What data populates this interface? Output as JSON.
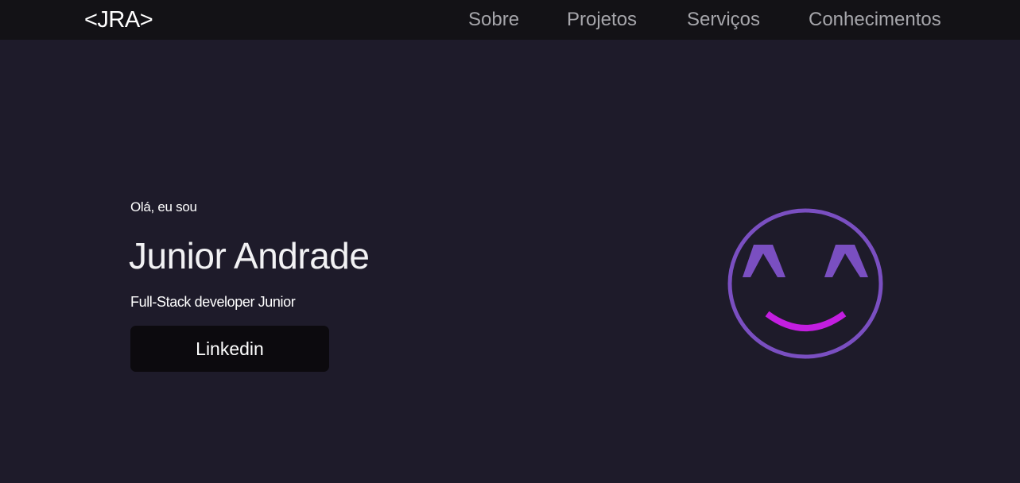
{
  "navbar": {
    "logo": "<JRA>",
    "items": [
      {
        "label": "Sobre"
      },
      {
        "label": "Projetos"
      },
      {
        "label": "Serviços"
      },
      {
        "label": "Conhecimentos"
      }
    ]
  },
  "hero": {
    "greeting": "Olá, eu sou",
    "name": "Junior Andrade",
    "role": "Full-Stack developer Junior",
    "button_label": "Linkedin"
  },
  "illustration": {
    "icon": "smiley-face-icon",
    "face_color": "#7a4fc1",
    "smile_color": "#c31ee0"
  },
  "colors": {
    "background": "#1e1b2a",
    "navbar_background": "#131216",
    "nav_text": "#a6a6ab",
    "button_background": "#0c0a0e"
  }
}
